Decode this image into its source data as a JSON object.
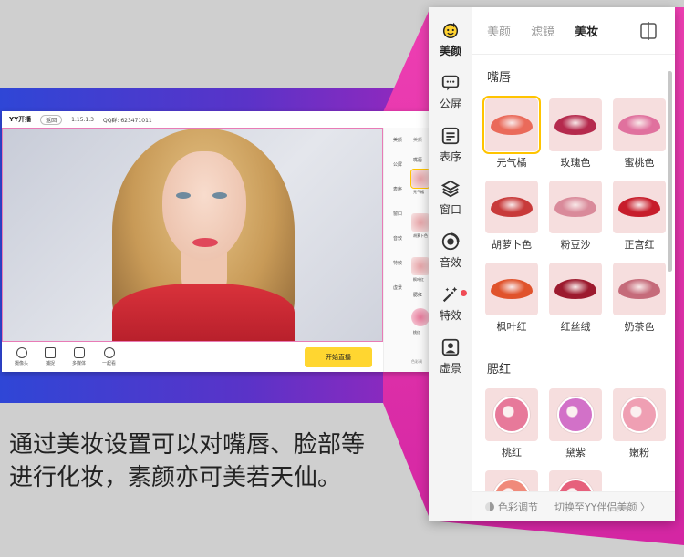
{
  "preview": {
    "app_logo": "YY开播",
    "back_label": "返回",
    "version": "1.15.1.3",
    "qq_group": "QQ群: 623471011",
    "tools": [
      "摄像头",
      "捕捉",
      "多媒体",
      "一起看"
    ],
    "live_button": "开始直播",
    "side_labels": [
      "美颜",
      "公屏",
      "表序",
      "窗口",
      "音效",
      "特效",
      "虚景"
    ],
    "side_tab": "美颜",
    "side_section": "嘴唇",
    "side_swatch_labels": [
      "元气橘",
      "胡萝卜色",
      "枫叶红"
    ],
    "side_blush_label": "腮红",
    "side_blush_item": "桃红",
    "side_bottom": "色彩调"
  },
  "caption": {
    "line1": "通过美妆设置可以对嘴唇、脸部等",
    "line2": "进行化妆，素颜亦可美若天仙。"
  },
  "panel": {
    "rail": [
      {
        "label": "美颜",
        "icon": "beauty-face-icon"
      },
      {
        "label": "公屏",
        "icon": "chat-screen-icon"
      },
      {
        "label": "表序",
        "icon": "list-order-icon"
      },
      {
        "label": "窗口",
        "icon": "window-layers-icon"
      },
      {
        "label": "音效",
        "icon": "sound-effect-icon"
      },
      {
        "label": "特效",
        "icon": "magic-wand-icon"
      },
      {
        "label": "虚景",
        "icon": "virtual-background-icon"
      }
    ],
    "tabs": [
      "美颜",
      "滤镜",
      "美妆"
    ],
    "active_tab": "美妆",
    "lips_title": "嘴唇",
    "lips": [
      {
        "label": "元气橘",
        "color": "#ea6a5a",
        "selected": true
      },
      {
        "label": "玫瑰色",
        "color": "#b52a4d",
        "selected": false
      },
      {
        "label": "蜜桃色",
        "color": "#e0719e",
        "selected": false
      },
      {
        "label": "胡萝卜色",
        "color": "#c83a3a",
        "selected": false
      },
      {
        "label": "粉豆沙",
        "color": "#d98a9a",
        "selected": false
      },
      {
        "label": "正宫红",
        "color": "#c71d2b",
        "selected": false
      },
      {
        "label": "枫叶红",
        "color": "#e0532c",
        "selected": false
      },
      {
        "label": "红丝绒",
        "color": "#9c1a2e",
        "selected": false
      },
      {
        "label": "奶茶色",
        "color": "#c56b7a",
        "selected": false
      }
    ],
    "blush_title": "腮红",
    "blush": [
      {
        "label": "桃红",
        "color": "#e7799a"
      },
      {
        "label": "黛紫",
        "color": "#d271c8"
      },
      {
        "label": "嫩粉",
        "color": "#ef9fb3"
      },
      {
        "label": "",
        "color": "#f08a7a"
      },
      {
        "label": "",
        "color": "#e6607c"
      }
    ],
    "bottom": {
      "color_adjust": "色彩调节",
      "switch_label": "切换至YY伴侣美颜 〉"
    },
    "colors": {
      "highlight": "#ffc400",
      "notify": "#f04b55"
    }
  }
}
